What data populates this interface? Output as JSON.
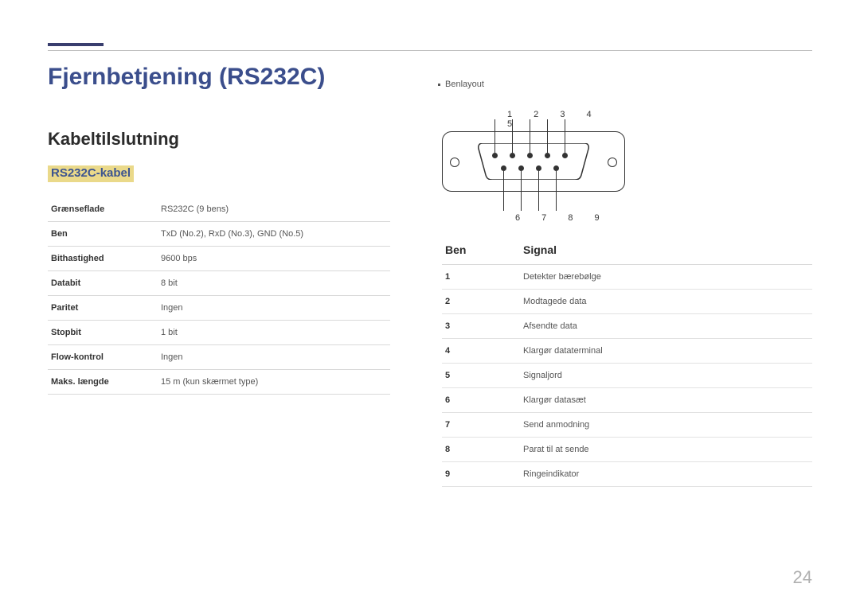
{
  "title": "Fjernbetjening (RS232C)",
  "section": "Kabeltilslutning",
  "subsection": "RS232C-kabel",
  "spec": {
    "rows": [
      {
        "k": "Grænseflade",
        "v": "RS232C (9 bens)"
      },
      {
        "k": "Ben",
        "v": "TxD (No.2), RxD (No.3), GND (No.5)"
      },
      {
        "k": "Bithastighed",
        "v": "9600 bps"
      },
      {
        "k": "Databit",
        "v": "8 bit"
      },
      {
        "k": "Paritet",
        "v": "Ingen"
      },
      {
        "k": "Stopbit",
        "v": "1 bit"
      },
      {
        "k": "Flow-kontrol",
        "v": "Ingen"
      },
      {
        "k": "Maks. længde",
        "v": "15 m (kun skærmet type)"
      }
    ]
  },
  "pin_layout_label": "Benlayout",
  "pin_num_top": "1 2 3 4 5",
  "pin_num_bot": "6 7 8 9",
  "sig_header": {
    "pin": "Ben",
    "signal": "Signal"
  },
  "signals": [
    {
      "n": "1",
      "s": "Detekter bærebølge"
    },
    {
      "n": "2",
      "s": "Modtagede data"
    },
    {
      "n": "3",
      "s": "Afsendte data"
    },
    {
      "n": "4",
      "s": "Klargør dataterminal"
    },
    {
      "n": "5",
      "s": "Signaljord"
    },
    {
      "n": "6",
      "s": "Klargør datasæt"
    },
    {
      "n": "7",
      "s": "Send anmodning"
    },
    {
      "n": "8",
      "s": "Parat til at sende"
    },
    {
      "n": "9",
      "s": "Ringeindikator"
    }
  ],
  "page_number": "24"
}
